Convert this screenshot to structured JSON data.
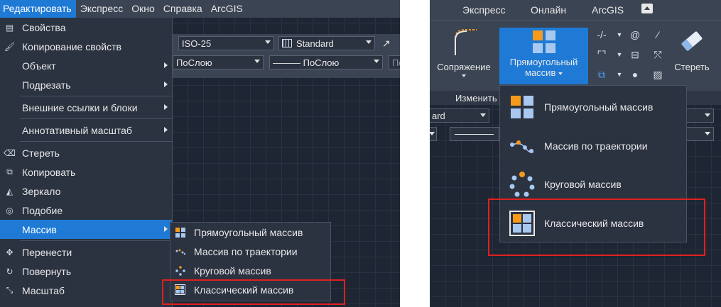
{
  "left": {
    "menubar": [
      {
        "label": "Редактировать",
        "active": true
      },
      {
        "label": "Экспресс"
      },
      {
        "label": "Окно"
      },
      {
        "label": "Справка"
      },
      {
        "label": "ArcGIS"
      }
    ],
    "toolbar": {
      "dimstyle": "ISO-25",
      "tablestyle": "Standard",
      "layer": "ПоСлою",
      "linetype": "——— ПоСлою",
      "lineweight": "По"
    },
    "edit_menu": {
      "properties": "Свойства",
      "match_properties": "Копирование свойств",
      "object": "Объект",
      "trim": "Подрезать",
      "xrefs_blocks": "Внешние ссылки и блоки",
      "annotative_scale": "Аннотативный масштаб",
      "erase": "Стереть",
      "copy": "Копировать",
      "mirror": "Зеркало",
      "offset": "Подобие",
      "array": "Массив",
      "move": "Перенести",
      "rotate": "Повернуть",
      "scale": "Масштаб"
    },
    "array_submenu": {
      "rect": "Прямоугольный массив",
      "path": "Массив по траектории",
      "polar": "Круговой массив",
      "classic": "Классический массив"
    }
  },
  "right": {
    "tabs": {
      "express": "Экспресс",
      "online": "Онлайн",
      "arcgis": "ArcGIS"
    },
    "ribbon": {
      "fillet_label": "Сопряжение",
      "array_label_1": "Прямоугольный",
      "array_label_2": "массив",
      "erase_label": "Стереть",
      "panel_title": "Изменить",
      "combo_standard": "ard"
    },
    "dropdown": {
      "rect": "Прямоугольный массив",
      "path": "Массив по траектории",
      "polar": "Круговой массив",
      "classic": "Классический массив"
    }
  },
  "colors": {
    "accent": "#1f7ad6",
    "highlight_box": "#e02020",
    "orange": "#f59a1b",
    "light_blue": "#a8c8f0"
  }
}
